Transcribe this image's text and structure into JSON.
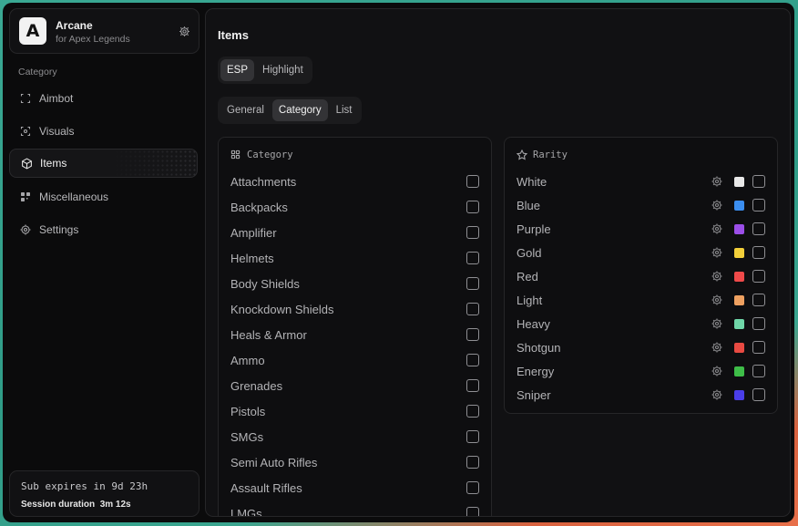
{
  "brand": {
    "letter": "A",
    "name": "Arcane",
    "subtitle": "for Apex Legends"
  },
  "sidebar": {
    "category_label": "Category",
    "items": [
      {
        "label": "Aimbot",
        "icon": "crosshair-icon"
      },
      {
        "label": "Visuals",
        "icon": "scan-eye-icon"
      },
      {
        "label": "Items",
        "icon": "box-icon",
        "active": true
      },
      {
        "label": "Miscellaneous",
        "icon": "blocks-icon"
      },
      {
        "label": "Settings",
        "icon": "gear-icon"
      }
    ]
  },
  "subscription": {
    "expires": "Sub expires in 9d 23h",
    "session_label": "Session duration",
    "session_value": "3m 12s"
  },
  "main": {
    "title": "Items",
    "mode_tabs": [
      {
        "label": "ESP",
        "selected": true
      },
      {
        "label": "Highlight",
        "selected": false
      }
    ],
    "view_tabs": [
      {
        "label": "General",
        "selected": false
      },
      {
        "label": "Category",
        "selected": true
      },
      {
        "label": "List",
        "selected": false
      }
    ],
    "category_panel": {
      "heading": "Category",
      "items": [
        "Attachments",
        "Backpacks",
        "Amplifier",
        "Helmets",
        "Body Shields",
        "Knockdown Shields",
        "Heals & Armor",
        "Ammo",
        "Grenades",
        "Pistols",
        "SMGs",
        "Semi Auto Rifles",
        "Assault Rifles",
        "LMGs"
      ]
    },
    "rarity_panel": {
      "heading": "Rarity",
      "items": [
        {
          "label": "White",
          "color": "#e8e8e8"
        },
        {
          "label": "Blue",
          "color": "#3b8ef0"
        },
        {
          "label": "Purple",
          "color": "#9b4ee8"
        },
        {
          "label": "Gold",
          "color": "#f2cf3a"
        },
        {
          "label": "Red",
          "color": "#ef4a4a"
        },
        {
          "label": "Light",
          "color": "#eea060"
        },
        {
          "label": "Heavy",
          "color": "#6fd6a8"
        },
        {
          "label": "Shotgun",
          "color": "#e84a42"
        },
        {
          "label": "Energy",
          "color": "#3ebd48"
        },
        {
          "label": "Sniper",
          "color": "#4a3ee8"
        }
      ]
    }
  }
}
